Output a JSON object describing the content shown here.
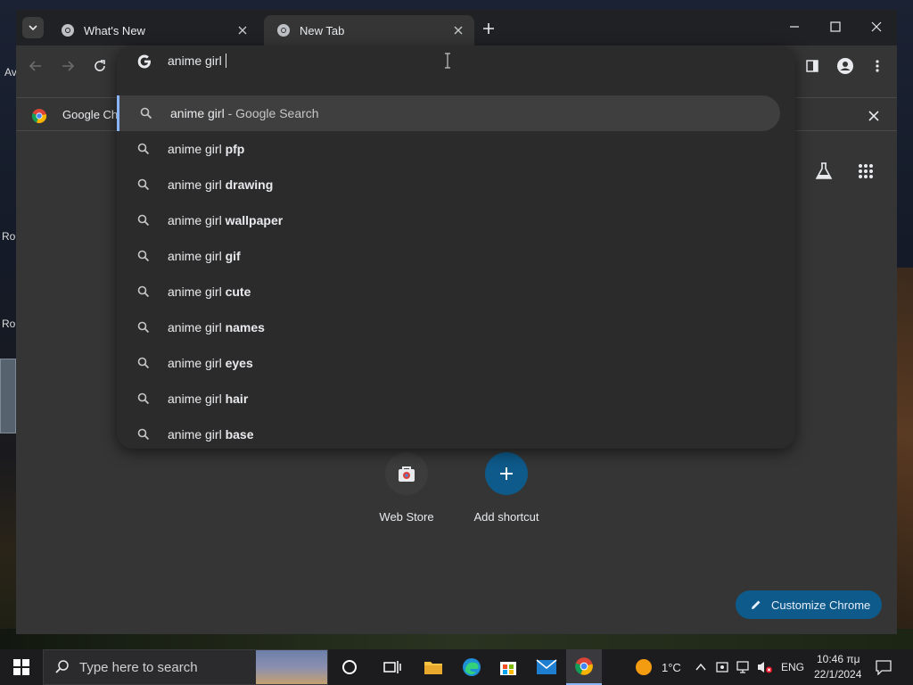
{
  "browser": {
    "tabs": [
      {
        "title": "What's New",
        "active": false
      },
      {
        "title": "New Tab",
        "active": true
      }
    ]
  },
  "omnibox": {
    "query": "anime girl",
    "suggestions": [
      {
        "prefix": "anime girl",
        "bold": "",
        "suffix": "Google Search",
        "separator": " - "
      },
      {
        "prefix": "anime girl",
        "bold": "pfp"
      },
      {
        "prefix": "anime girl",
        "bold": "drawing"
      },
      {
        "prefix": "anime girl",
        "bold": "wallpaper"
      },
      {
        "prefix": "anime girl",
        "bold": "gif"
      },
      {
        "prefix": "anime girl",
        "bold": "cute"
      },
      {
        "prefix": "anime girl",
        "bold": "names"
      },
      {
        "prefix": "anime girl",
        "bold": "eyes"
      },
      {
        "prefix": "anime girl",
        "bold": "hair"
      },
      {
        "prefix": "anime girl",
        "bold": "base"
      }
    ]
  },
  "infobar": {
    "text": "Google Ch"
  },
  "ntp": {
    "shortcuts": [
      {
        "label": "Web Store"
      },
      {
        "label": "Add shortcut"
      }
    ],
    "customize_label": "Customize Chrome"
  },
  "desktop": {
    "icon_labels": [
      "Av",
      "Ro",
      "Ro"
    ]
  },
  "taskbar": {
    "search_placeholder": "Type here to search",
    "weather": "1°C",
    "language": "ENG",
    "time": "10:46 πμ",
    "date": "22/1/2024"
  },
  "colors": {
    "accent": "#8ab4f8",
    "customize_bg": "#0e5a8a",
    "add_shortcut_bg": "#0e5a8a"
  }
}
